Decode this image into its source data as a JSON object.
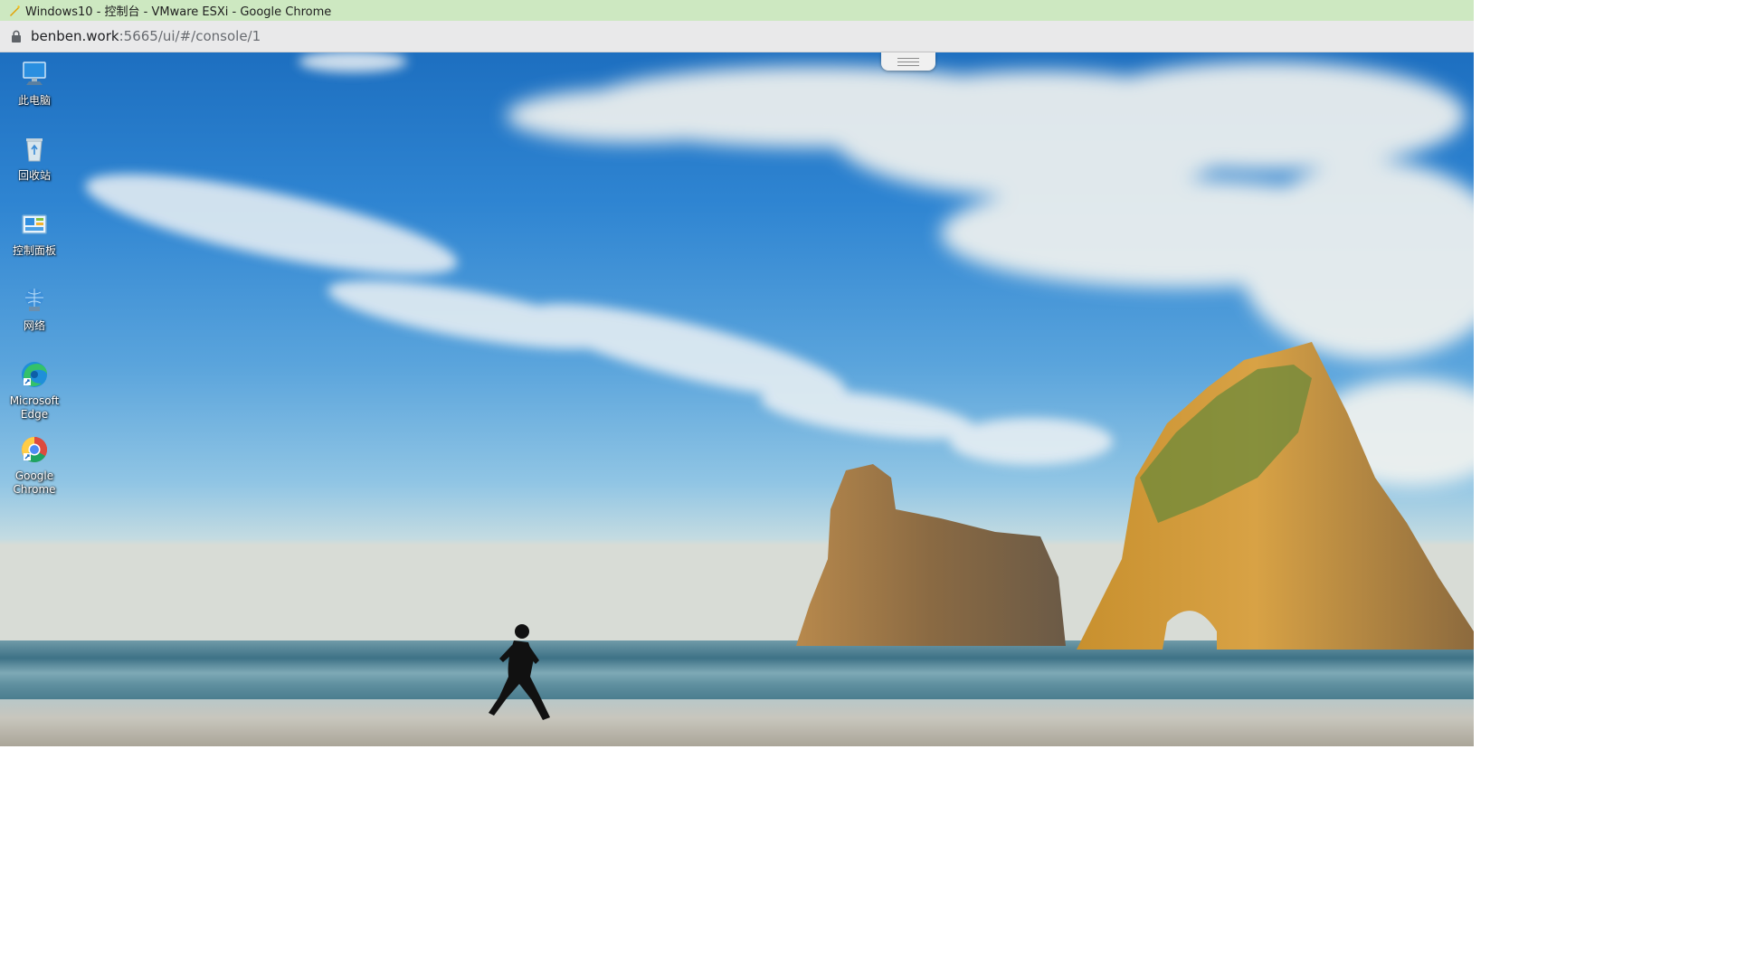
{
  "window": {
    "title": "Windows10 - 控制台 - VMware ESXi - Google Chrome"
  },
  "address_bar": {
    "host": "benben.work",
    "path": ":5665/ui/#/console/1"
  },
  "desktop": {
    "icons": [
      {
        "label": "此电脑",
        "icon": "this-pc-icon"
      },
      {
        "label": "回收站",
        "icon": "recycle-bin-icon"
      },
      {
        "label": "控制面板",
        "icon": "control-panel-icon"
      },
      {
        "label": "网络",
        "icon": "network-icon"
      },
      {
        "label": "Microsoft Edge",
        "icon": "edge-icon"
      },
      {
        "label": "Google Chrome",
        "icon": "chrome-icon"
      }
    ]
  },
  "colors": {
    "title_bar": "#cde8c1",
    "address_bar": "#e9e9ea"
  }
}
